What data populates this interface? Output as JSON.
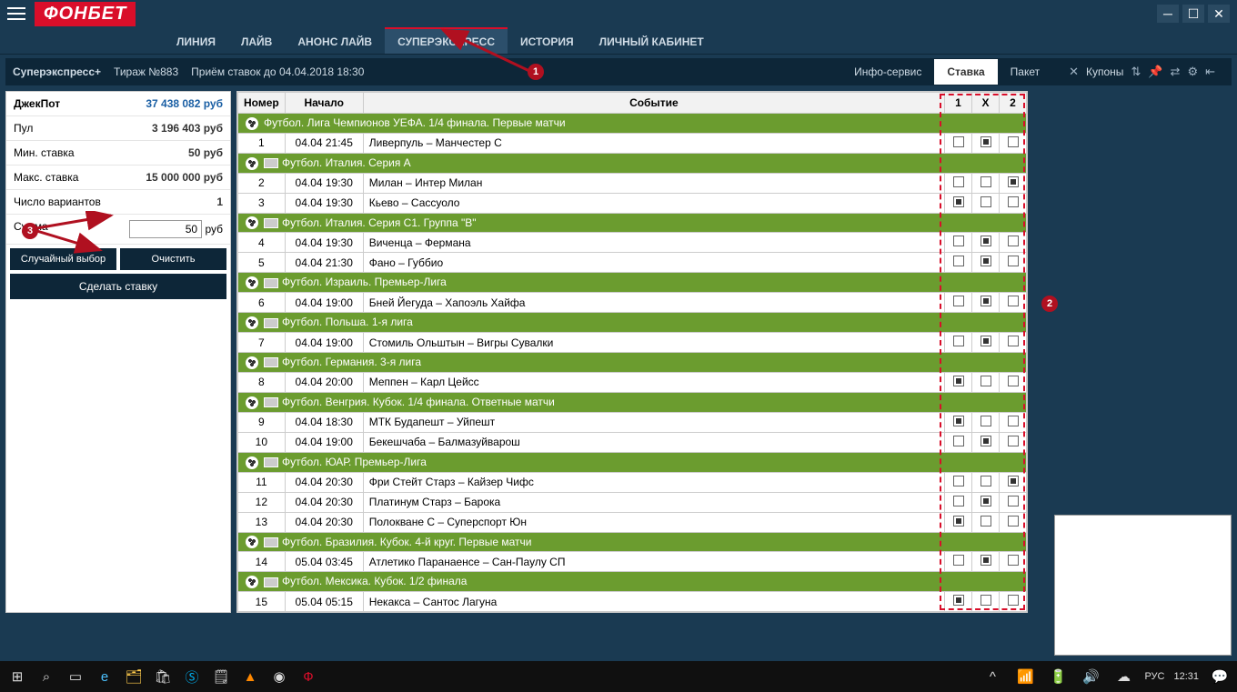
{
  "brand": "ФОНБЕТ",
  "nav": [
    "ЛИНИЯ",
    "ЛАЙВ",
    "АНОНС ЛАЙВ",
    "СУПЕРЭКСПРЕСС",
    "ИСТОРИЯ",
    "ЛИЧНЫЙ КАБИНЕТ"
  ],
  "nav_active": 3,
  "subhead": {
    "title": "Суперэкспресс+",
    "draw": "Тираж №883",
    "deadline": "Приём ставок до 04.04.2018 18:30",
    "info": "Инфо-сервис",
    "tabs": [
      "Ставка",
      "Пакет"
    ],
    "tab_active": 0,
    "coupons": "Купоны"
  },
  "panel": {
    "jackpot_l": "ДжекПот",
    "jackpot_v": "37 438 082 руб",
    "pool_l": "Пул",
    "pool_v": "3 196 403 руб",
    "min_l": "Мин. ставка",
    "min_v": "50 руб",
    "max_l": "Макс. ставка",
    "max_v": "15 000 000 руб",
    "variants_l": "Число вариантов",
    "variants_v": "1",
    "sum_l": "Сумма",
    "sum_v": "50",
    "sum_u": "руб",
    "random": "Случайный выбор",
    "clear": "Очистить",
    "submit": "Сделать ставку"
  },
  "cols": {
    "num": "Номер",
    "start": "Начало",
    "event": "Событие",
    "c1": "1",
    "cx": "X",
    "c2": "2"
  },
  "rows": [
    {
      "grp": "Футбол. Лига Чемпионов УЕФА. 1/4 финала. Первые матчи"
    },
    {
      "n": "1",
      "t": "04.04  21:45",
      "e": "Ливерпуль – Манчестер С",
      "p": [
        0,
        1,
        0
      ]
    },
    {
      "grp": "Футбол. Италия. Серия А",
      "flag": "it"
    },
    {
      "n": "2",
      "t": "04.04  19:30",
      "e": "Милан – Интер Милан",
      "p": [
        0,
        0,
        1
      ]
    },
    {
      "n": "3",
      "t": "04.04  19:30",
      "e": "Кьево – Сассуоло",
      "p": [
        1,
        0,
        0
      ]
    },
    {
      "grp": "Футбол. Италия. Серия С1. Группа \"B\"",
      "flag": "it"
    },
    {
      "n": "4",
      "t": "04.04  19:30",
      "e": "Виченца – Фермана",
      "p": [
        0,
        1,
        0
      ]
    },
    {
      "n": "5",
      "t": "04.04  21:30",
      "e": "Фано – Губбио",
      "p": [
        0,
        1,
        0
      ]
    },
    {
      "grp": "Футбол. Израиль. Премьер-Лига",
      "flag": "il"
    },
    {
      "n": "6",
      "t": "04.04  19:00",
      "e": "Бней Йегуда – Хапоэль Хайфа",
      "p": [
        0,
        1,
        0
      ]
    },
    {
      "grp": "Футбол. Польша. 1-я лига",
      "flag": "pl"
    },
    {
      "n": "7",
      "t": "04.04  19:00",
      "e": "Стомиль Ольштын – Вигры Сувалки",
      "p": [
        0,
        1,
        0
      ]
    },
    {
      "grp": "Футбол. Германия. 3-я лига",
      "flag": "de"
    },
    {
      "n": "8",
      "t": "04.04  20:00",
      "e": "Меппен – Карл Цейсс",
      "p": [
        1,
        0,
        0
      ]
    },
    {
      "grp": "Футбол. Венгрия. Кубок. 1/4 финала. Ответные матчи",
      "flag": "hu"
    },
    {
      "n": "9",
      "t": "04.04  18:30",
      "e": "МТК Будапешт – Уйпешт",
      "p": [
        1,
        0,
        0
      ]
    },
    {
      "n": "10",
      "t": "04.04  19:00",
      "e": "Бекешчаба – Балмазуйварош",
      "p": [
        0,
        1,
        0
      ]
    },
    {
      "grp": "Футбол. ЮАР. Премьер-Лига",
      "flag": "za"
    },
    {
      "n": "11",
      "t": "04.04  20:30",
      "e": "Фри Стейт Старз – Кайзер Чифс",
      "p": [
        0,
        0,
        1
      ]
    },
    {
      "n": "12",
      "t": "04.04  20:30",
      "e": "Платинум Старз – Барока",
      "p": [
        0,
        1,
        0
      ]
    },
    {
      "n": "13",
      "t": "04.04  20:30",
      "e": "Полокване С – Суперспорт Юн",
      "p": [
        1,
        0,
        0
      ]
    },
    {
      "grp": "Футбол. Бразилия. Кубок. 4-й круг. Первые матчи",
      "flag": "br"
    },
    {
      "n": "14",
      "t": "05.04  03:45",
      "e": "Атлетико Паранаенсе – Сан-Паулу СП",
      "p": [
        0,
        1,
        0
      ]
    },
    {
      "grp": "Футбол. Мексика. Кубок. 1/2 финала",
      "flag": "mx"
    },
    {
      "n": "15",
      "t": "05.04  05:15",
      "e": "Некакса – Сантос Лагуна",
      "p": [
        1,
        0,
        0
      ]
    }
  ],
  "callouts": {
    "c1": "1",
    "c2": "2",
    "c3": "3"
  },
  "taskbar": {
    "lang": "РУС",
    "time": "12:31"
  }
}
